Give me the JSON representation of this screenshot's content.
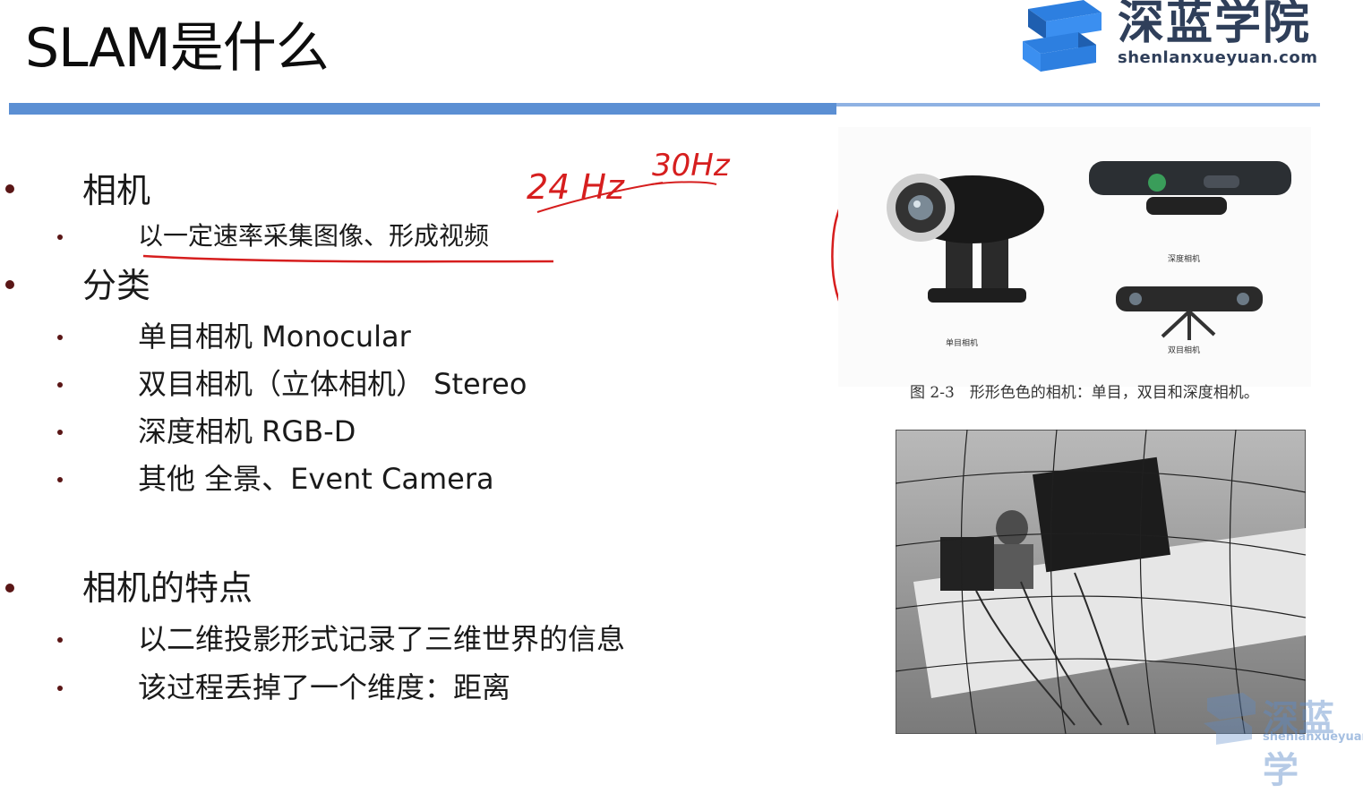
{
  "slide": {
    "title": "SLAM是什么",
    "logo": {
      "cn": "深蓝学院",
      "en": "shenlanxueyuan.com",
      "color": "#2f3f5a",
      "accent": "#2d7fe0"
    },
    "accent_bar_color": "#5b8fd3",
    "bullet_color": "#5a1616",
    "annotation_color": "#d61e1e",
    "sections": [
      {
        "heading": "相机",
        "items": [
          "以一定速率采集图像、形成视频"
        ]
      },
      {
        "heading": "分类",
        "items": [
          "单目相机 Monocular",
          "双目相机（立体相机） Stereo",
          "深度相机 RGB-D",
          "其他 全景、Event Camera"
        ]
      },
      {
        "heading": "相机的特点",
        "items": [
          "以二维投影形式记录了三维世界的信息",
          "该过程丢掉了一个维度：距离"
        ]
      }
    ],
    "handwriting": {
      "a": "24 Hz",
      "b": "30Hz"
    },
    "figure": {
      "labels": {
        "depth": "深度相机",
        "stereo": "双目相机",
        "mono": "单目相机"
      },
      "caption": "图 2-3　形形色色的相机：单目，双目和深度相机。"
    },
    "watermark": {
      "cn": "深蓝学",
      "en": "shenlanxueyuan"
    }
  }
}
